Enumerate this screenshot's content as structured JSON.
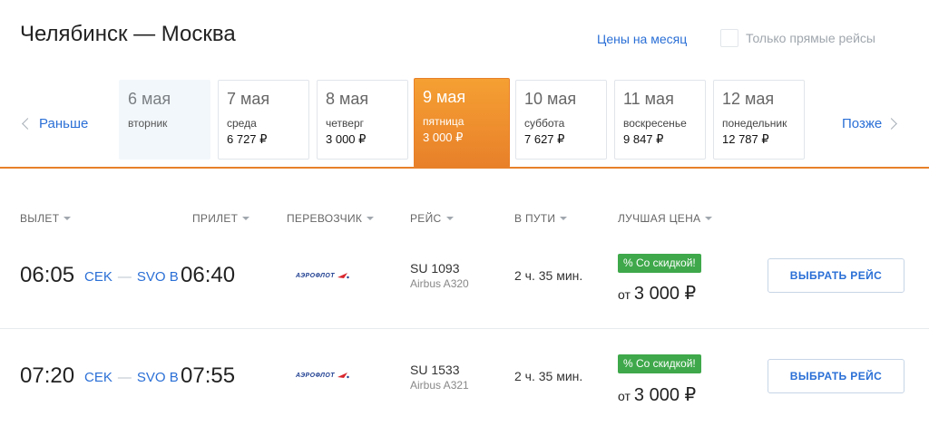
{
  "header": {
    "title": "Челябинск — Москва",
    "month_prices_link": "Цены на месяц",
    "direct_only_label": "Только прямые рейсы"
  },
  "calendar": {
    "prev_label": "Раньше",
    "next_label": "Позже",
    "days": [
      {
        "date": "6 мая",
        "weekday": "вторник",
        "price": ""
      },
      {
        "date": "7 мая",
        "weekday": "среда",
        "price": "6 727 ₽"
      },
      {
        "date": "8 мая",
        "weekday": "четверг",
        "price": "3 000 ₽"
      },
      {
        "date": "9 мая",
        "weekday": "пятница",
        "price": "3 000 ₽"
      },
      {
        "date": "10 мая",
        "weekday": "суббота",
        "price": "7 627 ₽"
      },
      {
        "date": "11 мая",
        "weekday": "воскресенье",
        "price": "9 847 ₽"
      },
      {
        "date": "12 мая",
        "weekday": "понедельник",
        "price": "12 787 ₽"
      }
    ],
    "selected_index": 3
  },
  "columns": {
    "departure": "ВЫЛЕТ",
    "arrival": "ПРИЛЕТ",
    "carrier": "ПЕРЕВОЗЧИК",
    "flight": "РЕЙС",
    "duration": "В ПУТИ",
    "best_price": "ЛУЧШАЯ ЦЕНА"
  },
  "flights": [
    {
      "departure_time": "06:05",
      "route_from": "CEK",
      "route_dash": "—",
      "route_to": "SVO B",
      "arrival_time": "06:40",
      "carrier_logo_text": "АЭРОФЛОТ",
      "flight_number": "SU 1093",
      "aircraft": "Airbus A320",
      "duration": "2 ч. 35 мин.",
      "discount_badge": "% Со скидкой!",
      "price_prefix": "от",
      "price": "3 000 ₽",
      "select_label": "ВЫБРАТЬ РЕЙС"
    },
    {
      "departure_time": "07:20",
      "route_from": "CEK",
      "route_dash": "—",
      "route_to": "SVO B",
      "arrival_time": "07:55",
      "carrier_logo_text": "АЭРОФЛОТ",
      "flight_number": "SU 1533",
      "aircraft": "Airbus A321",
      "duration": "2 ч. 35 мин.",
      "discount_badge": "% Со скидкой!",
      "price_prefix": "от",
      "price": "3 000 ₽",
      "select_label": "ВЫБРАТЬ РЕЙС"
    }
  ],
  "colors": {
    "accent_orange": "#e8802a",
    "link_blue": "#2a6fd6",
    "discount_green": "#3ea84a",
    "aeroflot_blue": "#1f3f91",
    "aeroflot_red": "#d9262e"
  },
  "icons": {
    "prev": "chevron-left-icon",
    "next": "chevron-right-icon",
    "sort": "caret-down-icon",
    "carrier": "aeroflot-logo"
  }
}
